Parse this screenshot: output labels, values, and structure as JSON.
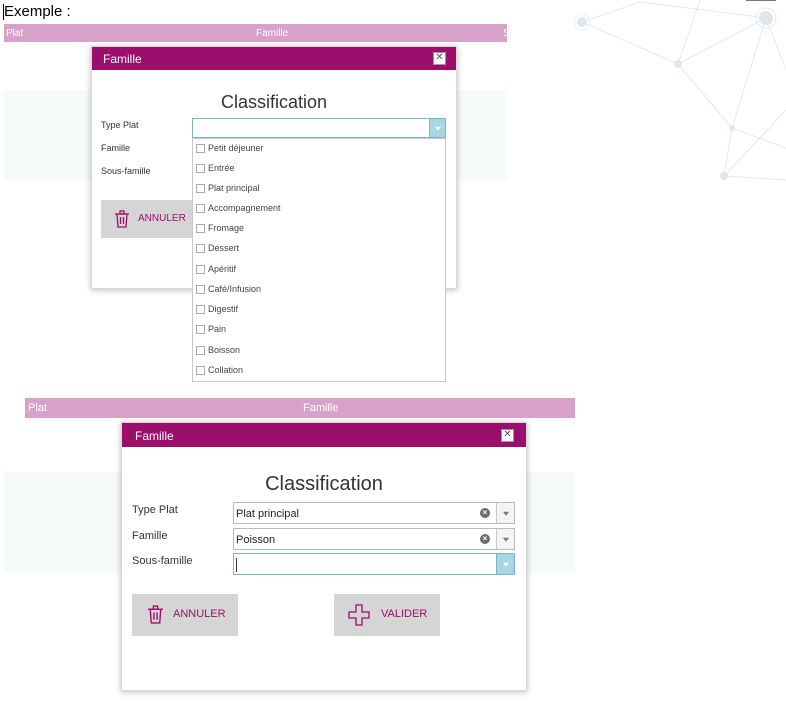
{
  "caption": "Exemple :",
  "colors": {
    "accent": "#9b0e6c",
    "header_bar": "#d7a1c9",
    "button_bg": "#d5d5d5",
    "focus": "#78b7c9"
  },
  "top": {
    "grid_header": {
      "plat": "Plat",
      "famille": "Famille",
      "third": "S"
    },
    "dialog": {
      "title": "Famille",
      "heading": "Classification",
      "labels": {
        "type_plat": "Type Plat",
        "famille": "Famille",
        "sous_famille": "Sous-famille"
      },
      "cancel_label": "ANNULER",
      "dropdown_options": [
        "Petit déjeuner",
        "Entrée",
        "Plat principal",
        "Accompagnement",
        "Fromage",
        "Dessert",
        "Apéritif",
        "Café/Infusion",
        "Digestif",
        "Pain",
        "Boisson",
        "Collation"
      ]
    }
  },
  "bottom": {
    "grid_header": {
      "plat": "Plat",
      "famille": "Famille"
    },
    "dialog": {
      "title": "Famille",
      "heading": "Classification",
      "labels": {
        "type_plat": "Type Plat",
        "famille": "Famille",
        "sous_famille": "Sous-famille"
      },
      "values": {
        "type_plat": "Plat principal",
        "famille": "Poisson",
        "sous_famille": ""
      },
      "cancel_label": "ANNULER",
      "validate_label": "VALIDER"
    }
  },
  "icons": {
    "close": "close-icon",
    "trash": "trash-icon",
    "plus": "plus-icon",
    "clear": "clear-circle-icon",
    "arrow": "chevron-down-icon"
  }
}
